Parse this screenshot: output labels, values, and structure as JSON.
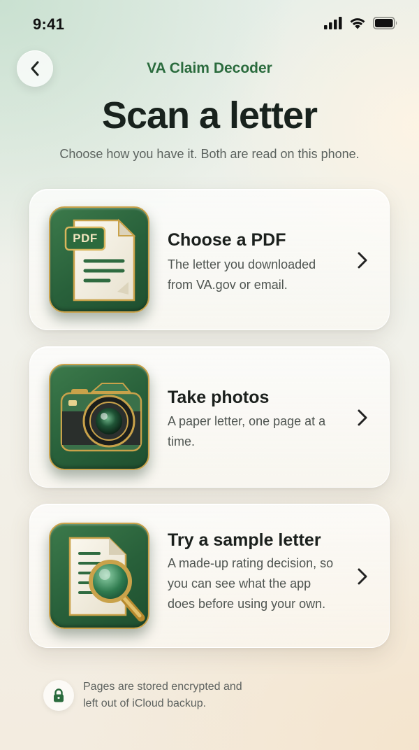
{
  "status_bar": {
    "time": "9:41"
  },
  "header": {
    "app_name": "VA Claim Decoder",
    "title": "Scan a letter",
    "subtitle": "Choose how you have it. Both are read on this phone."
  },
  "options": [
    {
      "title": "Choose a PDF",
      "description": "The letter you downloaded from VA.gov or email.",
      "icon": "pdf-document-icon",
      "badge": "PDF"
    },
    {
      "title": "Take photos",
      "description": "A paper letter, one page at a time.",
      "icon": "camera-icon"
    },
    {
      "title": "Try a sample letter",
      "description": "A made-up rating decision, so you can see what the app does before using your own.",
      "icon": "document-magnifier-icon"
    }
  ],
  "footer": {
    "note": "Pages are stored encrypted and left out of iCloud backup."
  },
  "colors": {
    "accent": "#2a6b3d",
    "icon_green": "#2f6b40",
    "gold": "#c9a24a"
  }
}
